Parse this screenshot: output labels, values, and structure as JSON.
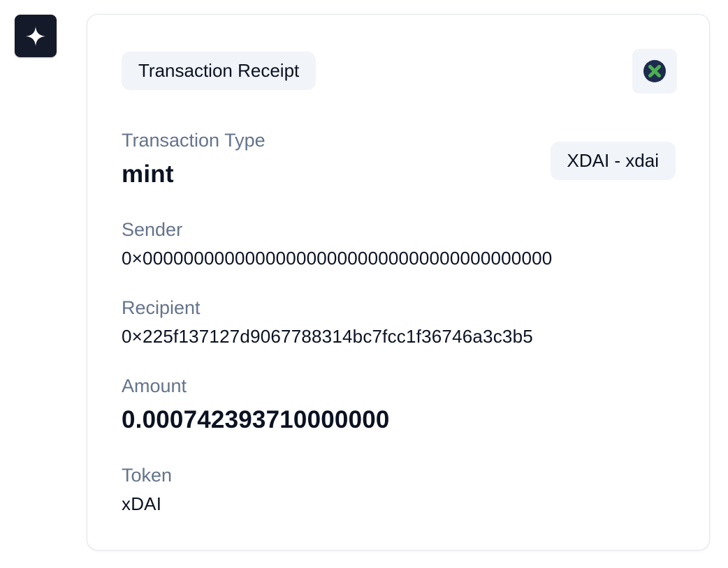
{
  "app": {
    "icon": "sparkle-icon"
  },
  "receipt": {
    "title": "Transaction Receipt",
    "close_icon": "close-icon",
    "network_label": "XDAI - xdai",
    "fields": {
      "type_label": "Transaction Type",
      "type_value": "mint",
      "sender_label": "Sender",
      "sender_value": "0×0000000000000000000000000000000000000000",
      "recipient_label": "Recipient",
      "recipient_value": "0×225f137127d9067788314bc7fcc1f36746a3c3b5",
      "amount_label": "Amount",
      "amount_value": "0.000742393710000000",
      "token_label": "Token",
      "token_value": "xDAI"
    }
  },
  "colors": {
    "icon_bg": "#151a2b",
    "close_circle": "#1e2b4f",
    "close_cross": "#4caf50",
    "label": "#64748b",
    "pill_bg": "#f1f4f8"
  }
}
